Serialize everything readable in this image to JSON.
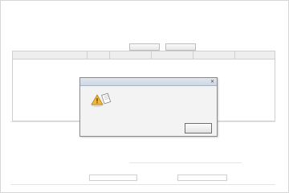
{
  "header": {
    "title": "",
    "accent": "#e03a2e"
  },
  "rows_top": [
    {
      "label": "",
      "links": [
        "",
        ""
      ]
    },
    {
      "label": "",
      "links": [
        "",
        "",
        "",
        "",
        ""
      ]
    },
    {
      "label": "",
      "links": [
        "",
        "",
        "",
        "",
        ""
      ]
    }
  ],
  "toolbar": {
    "btn1": "",
    "btn2": ""
  },
  "grid": {
    "columns": [
      "",
      "",
      "",
      "",
      "",
      ""
    ]
  },
  "dialog": {
    "title": "",
    "message": "",
    "ok": ""
  },
  "rows_bottom": [
    {
      "label": "",
      "value": "",
      "link": ""
    },
    {
      "label": "",
      "value": "",
      "link": ""
    },
    {
      "label": "",
      "value": "",
      "link": ""
    },
    {
      "label": "",
      "value": "",
      "link": ""
    },
    {
      "label": "",
      "value": "",
      "link": ""
    }
  ],
  "colors": {
    "link": "#2b3da8",
    "label": "#555555"
  }
}
